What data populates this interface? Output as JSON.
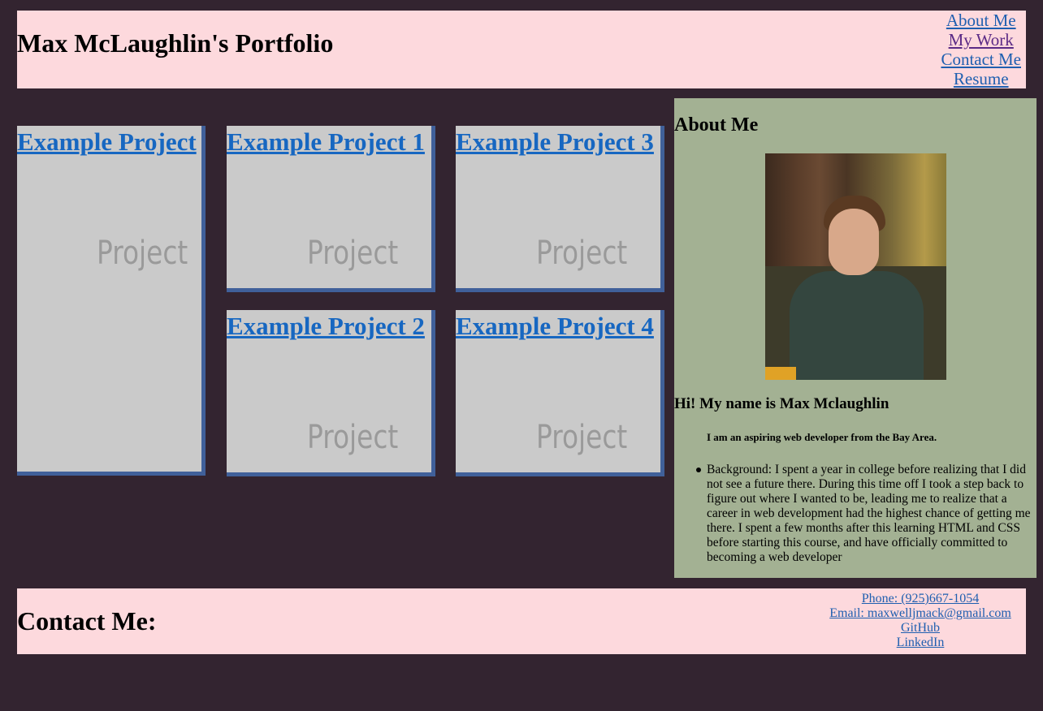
{
  "header": {
    "title": "Max McLaughlin's Portfolio",
    "nav": [
      {
        "label": "About Me"
      },
      {
        "label": "My Work"
      },
      {
        "label": "Contact Me"
      },
      {
        "label": "Resume"
      }
    ]
  },
  "projects": [
    {
      "title": "Example Project",
      "placeholder": "Project"
    },
    {
      "title": "Example Project 1",
      "placeholder": "Project"
    },
    {
      "title": "Example Project 3",
      "placeholder": "Project"
    },
    {
      "title": "Example Project 2",
      "placeholder": "Project"
    },
    {
      "title": "Example Project 4",
      "placeholder": "Project"
    }
  ],
  "about": {
    "heading": "About Me",
    "greeting": "Hi! My name is Max Mclaughlin",
    "tagline": "I am an aspiring web developer from the Bay Area.",
    "background": "Background: I spent a year in college before realizing that I did not see a future there. During this time off I took a step back to figure out where I wanted to be, leading me to realize that a career in web development had the highest chance of getting me there. I spent a few months after this learning HTML and CSS before starting this course, and have officially committed to becoming a web developer"
  },
  "footer": {
    "heading": "Contact Me:",
    "links": [
      {
        "label": "Phone: (925)667-1054"
      },
      {
        "label": "Email: maxwelljmack@gmail.com"
      },
      {
        "label": "GitHub"
      },
      {
        "label": "LinkedIn"
      }
    ]
  },
  "colors": {
    "background": "#332430",
    "header_bg": "#fdd9dd",
    "about_bg": "#a3b193",
    "link": "#1f5fb0",
    "project_border": "#40609a"
  }
}
